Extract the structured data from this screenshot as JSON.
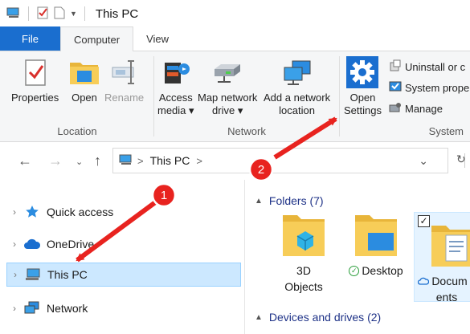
{
  "window": {
    "title": "This PC"
  },
  "tabs": {
    "file": "File",
    "computer": "Computer",
    "view": "View"
  },
  "ribbon": {
    "location": {
      "label": "Location",
      "properties": "Properties",
      "open": "Open",
      "rename": "Rename"
    },
    "network": {
      "label": "Network",
      "access_media": [
        "Access",
        "media ▾"
      ],
      "map_drive": [
        "Map network",
        "drive ▾"
      ],
      "add_location": [
        "Add a network",
        "location"
      ]
    },
    "system": {
      "label": "System",
      "open_settings": [
        "Open",
        "Settings"
      ],
      "uninstall": "Uninstall or c",
      "system_props": "System prope",
      "manage": "Manage"
    }
  },
  "address": {
    "path": "This PC",
    "sep": ">"
  },
  "navpane": {
    "items": [
      {
        "label": "Quick access"
      },
      {
        "label": "OneDrive"
      },
      {
        "label": "This PC"
      },
      {
        "label": "Network"
      }
    ]
  },
  "content": {
    "folders_header": "Folders (7)",
    "devices_header": "Devices and drives (2)",
    "folders": [
      {
        "label": [
          "3D",
          "Objects"
        ]
      },
      {
        "label": [
          "Desktop"
        ]
      },
      {
        "label": [
          "Docum",
          "ents"
        ]
      }
    ]
  },
  "callouts": [
    "1",
    "2"
  ],
  "colors": {
    "accent": "#1a6ecf",
    "arrow": "#e8231f",
    "selected_bg": "#cce8ff",
    "header_text": "#1e3287"
  }
}
